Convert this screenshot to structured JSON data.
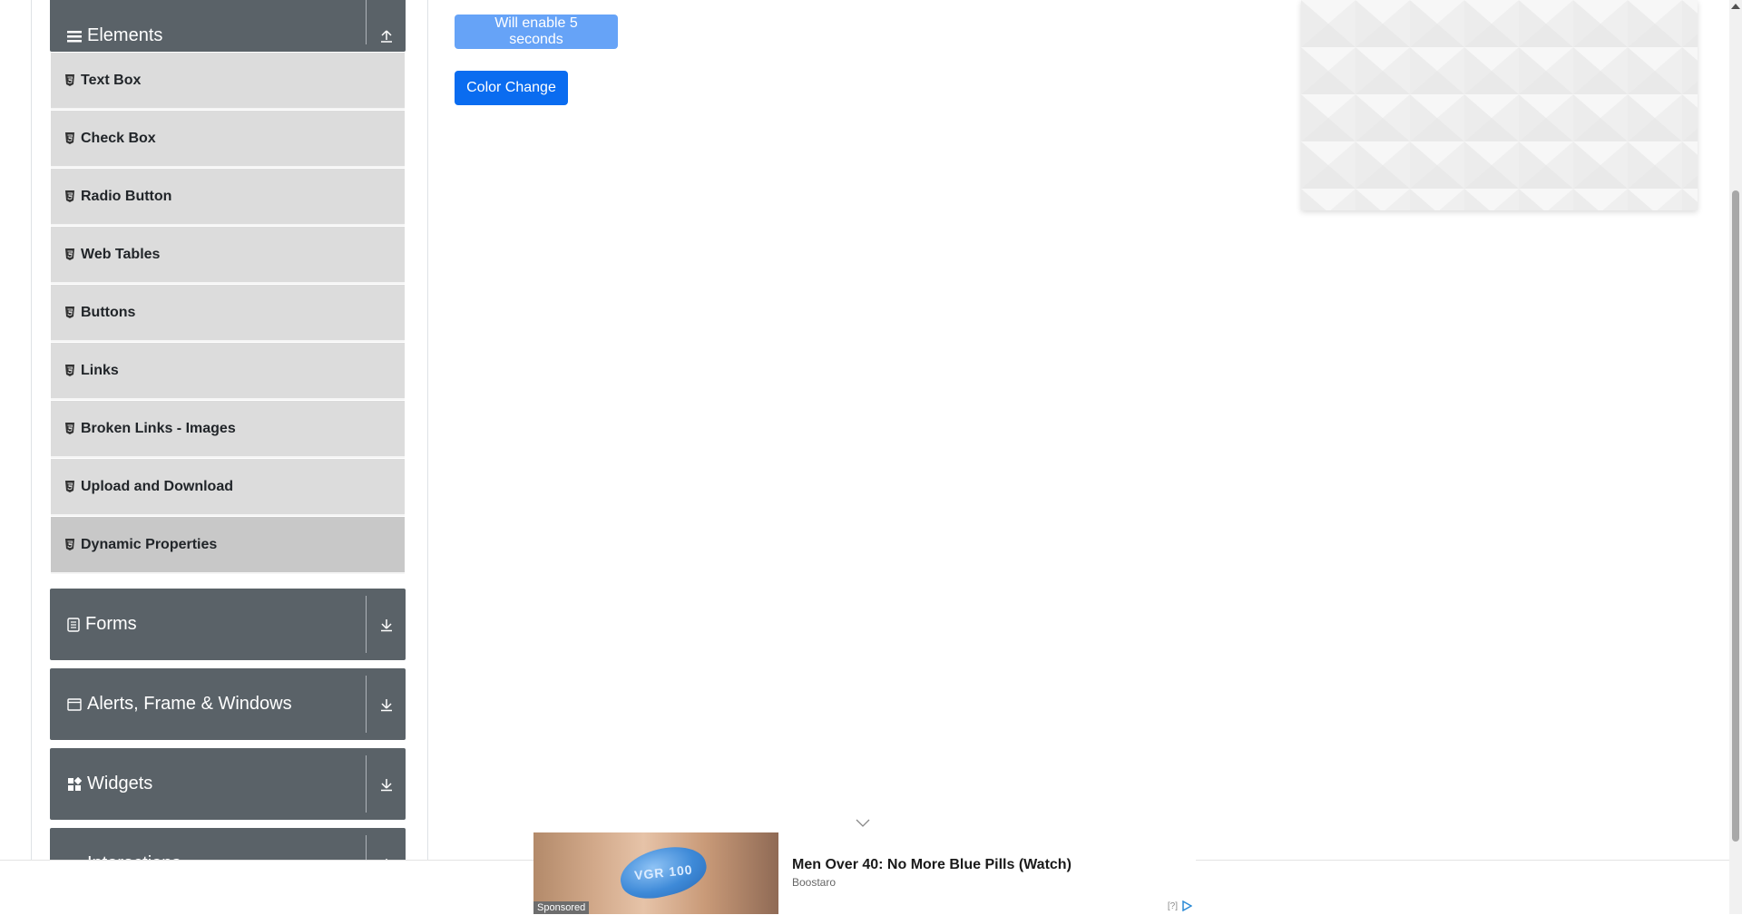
{
  "sidebar": {
    "groups": [
      {
        "label": "Elements",
        "icon": "hamburger-icon",
        "state": "expanded",
        "action_icon": "collapse-up-icon"
      },
      {
        "label": "Forms",
        "icon": "document-icon",
        "state": "collapsed",
        "action_icon": "expand-down-icon"
      },
      {
        "label": "Alerts, Frame & Windows",
        "icon": "window-icon",
        "state": "collapsed",
        "action_icon": "expand-down-icon"
      },
      {
        "label": "Widgets",
        "icon": "widgets-icon",
        "state": "collapsed",
        "action_icon": "expand-down-icon"
      },
      {
        "label": "Interactions",
        "icon": "interactions-icon",
        "state": "collapsed",
        "action_icon": "expand-down-icon"
      }
    ],
    "items": [
      {
        "label": "Text Box"
      },
      {
        "label": "Check Box"
      },
      {
        "label": "Radio Button"
      },
      {
        "label": "Web Tables"
      },
      {
        "label": "Buttons"
      },
      {
        "label": "Links"
      },
      {
        "label": "Broken Links - Images"
      },
      {
        "label": "Upload and Download"
      },
      {
        "label": "Dynamic Properties",
        "active": true
      }
    ],
    "item_icon": "html5-icon"
  },
  "main": {
    "enable_button_label": "Will enable 5 seconds",
    "color_change_label": "Color Change"
  },
  "ad": {
    "headline": "Men Over 40: No More Blue Pills (Watch)",
    "source": "Boostaro",
    "sponsored": "Sponsored",
    "pill_text": "VGR 100",
    "info": "[?]"
  },
  "colors": {
    "group_header_bg": "#5a6268",
    "menu_item_bg": "#dcdcdc",
    "primary": "#0a6cf0",
    "disabled": "#66a3f7"
  }
}
